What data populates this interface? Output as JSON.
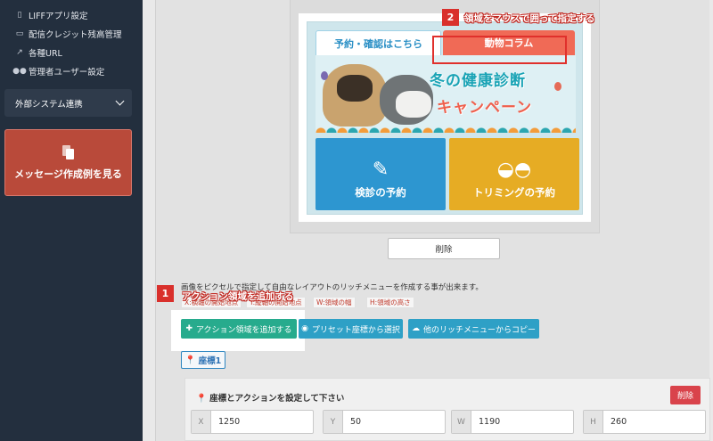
{
  "sidebar": {
    "items": [
      {
        "icon": "mobile-icon",
        "label": "LIFFアプリ設定"
      },
      {
        "icon": "money-icon",
        "label": "配信クレジット残高管理"
      },
      {
        "icon": "external-link-icon",
        "label": "各種URL"
      },
      {
        "icon": "users-icon",
        "label": "管理者ユーザー設定"
      }
    ],
    "external_section": "外部システム連携",
    "sample_button": "メッセージ作成例を見る"
  },
  "preview": {
    "tab_left": "予約・確認はこちら",
    "tab_right": "動物コラム",
    "banner_line1": "冬の健康診断",
    "banner_line2": "キャンペーン",
    "tile_left": "検診の予約",
    "tile_right": "トリミングの予約",
    "delete_label": "削除"
  },
  "editor": {
    "description": "画像をピクセルで指定して自由なレイアウトのリッチメニューを作成する事が出来ます。",
    "legend": [
      "X:横軸の開始地点",
      "Y:縦軸の開始地点",
      "W:領域の幅",
      "H:領域の高さ"
    ],
    "add_button": "アクション領域を追加する",
    "preset_button": "プリセット座標から選択",
    "copy_button": "他のリッチメニューからコピー",
    "coord_tag": "座標1",
    "coord_title": "座標とアクションを設定して下さい",
    "coord_delete": "削除",
    "fields": [
      {
        "label": "X",
        "value": "1250"
      },
      {
        "label": "Y",
        "value": "50"
      },
      {
        "label": "W",
        "value": "1190"
      },
      {
        "label": "H",
        "value": "260"
      }
    ]
  },
  "callouts": {
    "step1_number": "1",
    "step1_text": "アクション領域を追加する",
    "step2_number": "2",
    "step2_text": "領域をマウスで囲って指定する"
  },
  "colors": {
    "sidebar_bg": "#232f3e",
    "sample_button": "#b94a3a",
    "add_button": "#27ab8d",
    "secondary_button": "#2ea0c6",
    "callout_red": "#d9302c"
  }
}
